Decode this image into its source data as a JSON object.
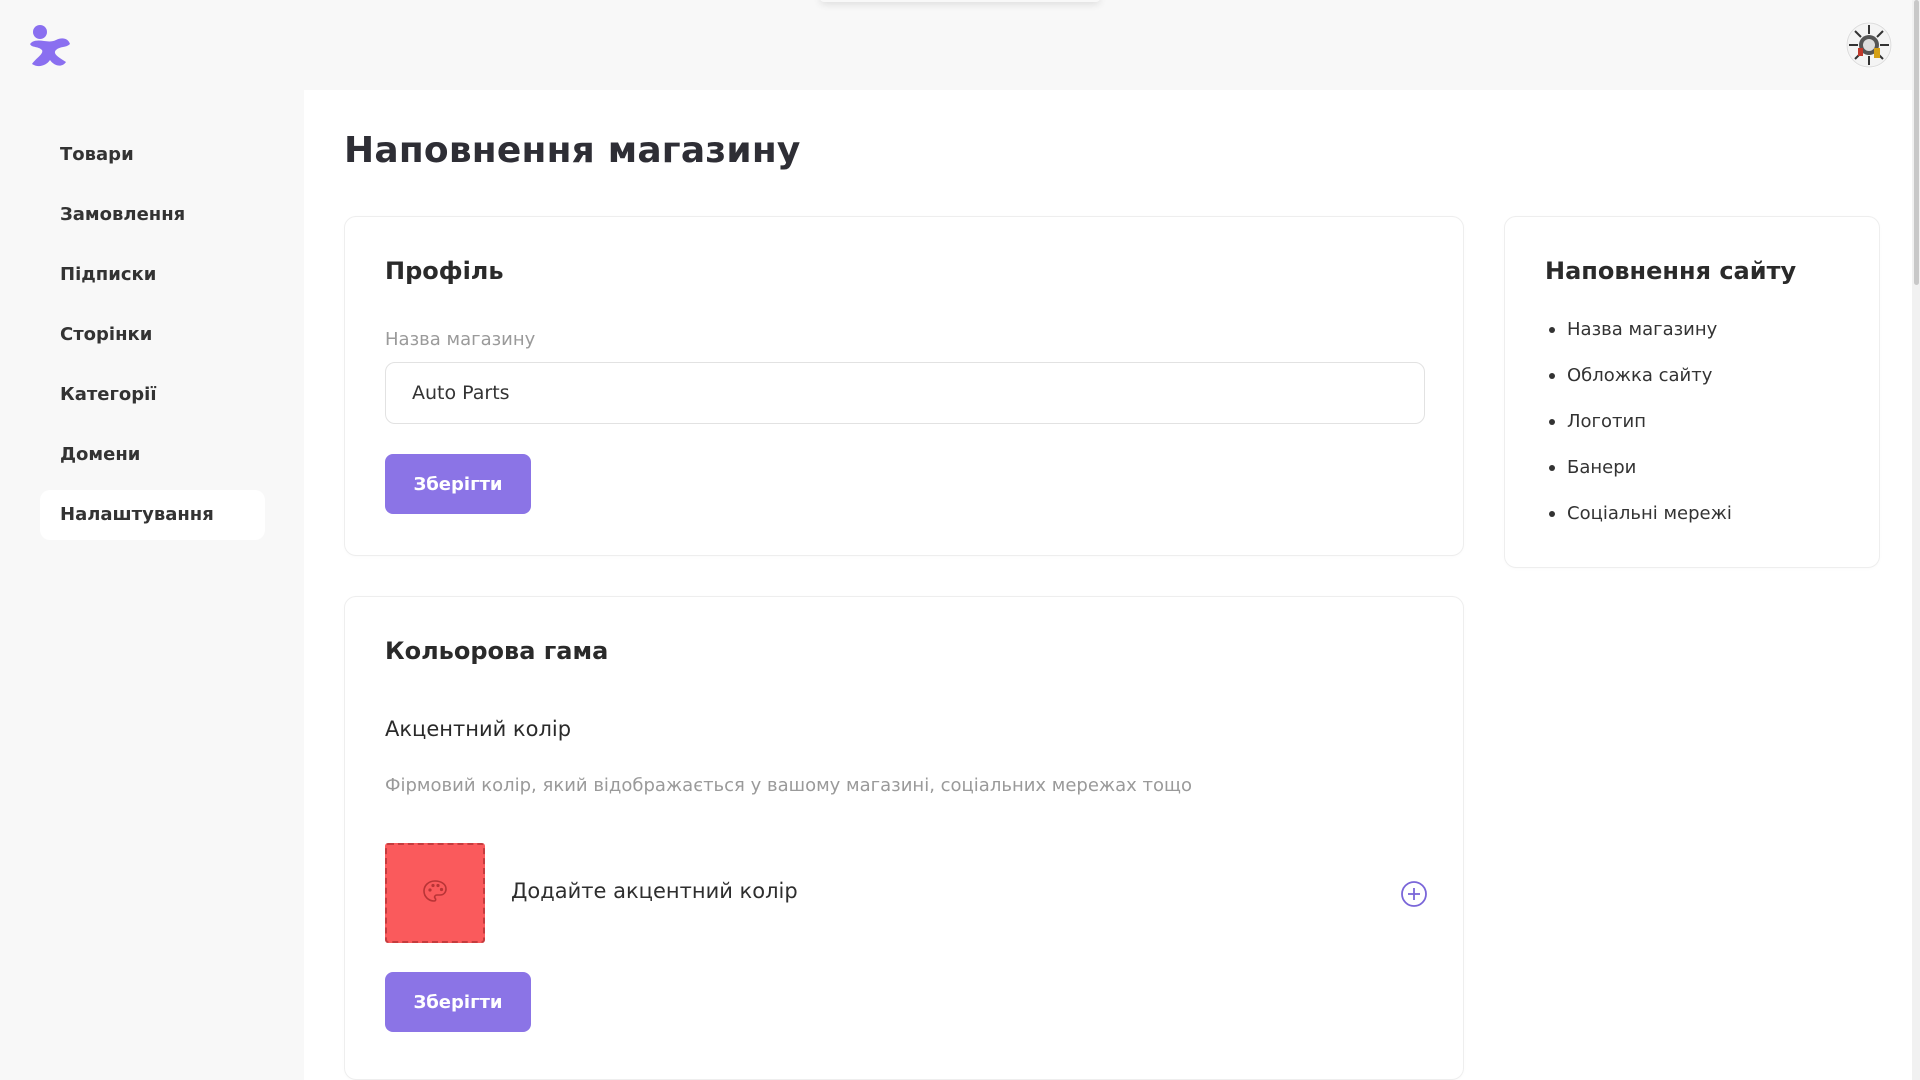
{
  "app": {
    "logo_icon": "brand-logo-icon",
    "avatar_icon": "user-avatar-icon"
  },
  "sidebar": {
    "items": [
      {
        "label": "Товари"
      },
      {
        "label": "Замовлення"
      },
      {
        "label": "Підписки"
      },
      {
        "label": "Сторінки"
      },
      {
        "label": "Категорії"
      },
      {
        "label": "Домени"
      },
      {
        "label": "Налаштування"
      }
    ],
    "active_index": 6
  },
  "page": {
    "title": "Наповнення магазину"
  },
  "profile_card": {
    "title": "Профіль",
    "field_label": "Назва магазину",
    "field_value": "Auto Parts",
    "save_label": "Зберігти"
  },
  "color_card": {
    "title": "Кольорова гама",
    "subtitle": "Акцентний колір",
    "description": "Фірмовий колір, який відображається у вашому магазині, соціальних мережах тощо",
    "add_label": "Додайте акцентний колір",
    "swatch_color": "#fa5a5c",
    "swatch_icon": "palette-icon",
    "add_icon": "plus-circle-icon",
    "save_label": "Зберігти"
  },
  "site_card": {
    "title": "Наповнення сайту",
    "items": [
      {
        "label": "Назва магазину"
      },
      {
        "label": "Обложка сайту"
      },
      {
        "label": "Логотип"
      },
      {
        "label": "Банери"
      },
      {
        "label": "Соціальні мережі"
      }
    ]
  },
  "colors": {
    "accent": "#8b74e6",
    "logo": "#8a6ff0"
  }
}
